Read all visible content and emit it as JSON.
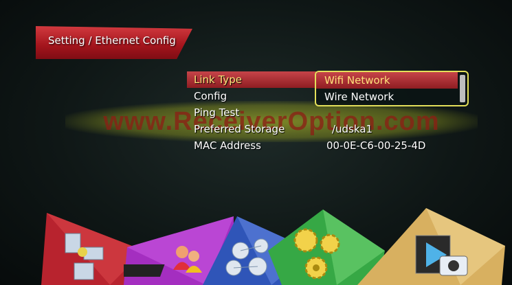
{
  "header": {
    "title": "Setting / Ethernet Config"
  },
  "watermark": {
    "text": "www.ReceiverOption.com"
  },
  "menu": {
    "items": [
      {
        "label": "Link Type",
        "value": ""
      },
      {
        "label": "Config",
        "value": ""
      },
      {
        "label": "Ping Test",
        "value": ""
      },
      {
        "label": "Preferred Storage",
        "value": "/udska1"
      },
      {
        "label": "MAC Address",
        "value": "00-0E-C6-00-25-4D"
      }
    ]
  },
  "dropdown": {
    "options": [
      "Wifi Network",
      "Wire Network"
    ],
    "selected": "Wifi Network"
  },
  "bottom_tiles": [
    {
      "icon": "satellite-icon",
      "color": "#b8232e"
    },
    {
      "icon": "user-tv-icon",
      "color": "#a42ec0"
    },
    {
      "icon": "network-globe-icon",
      "color": "#2f55b8"
    },
    {
      "icon": "gears-icon",
      "color": "#36a845"
    },
    {
      "icon": "media-icon",
      "color": "#d8b060"
    }
  ]
}
